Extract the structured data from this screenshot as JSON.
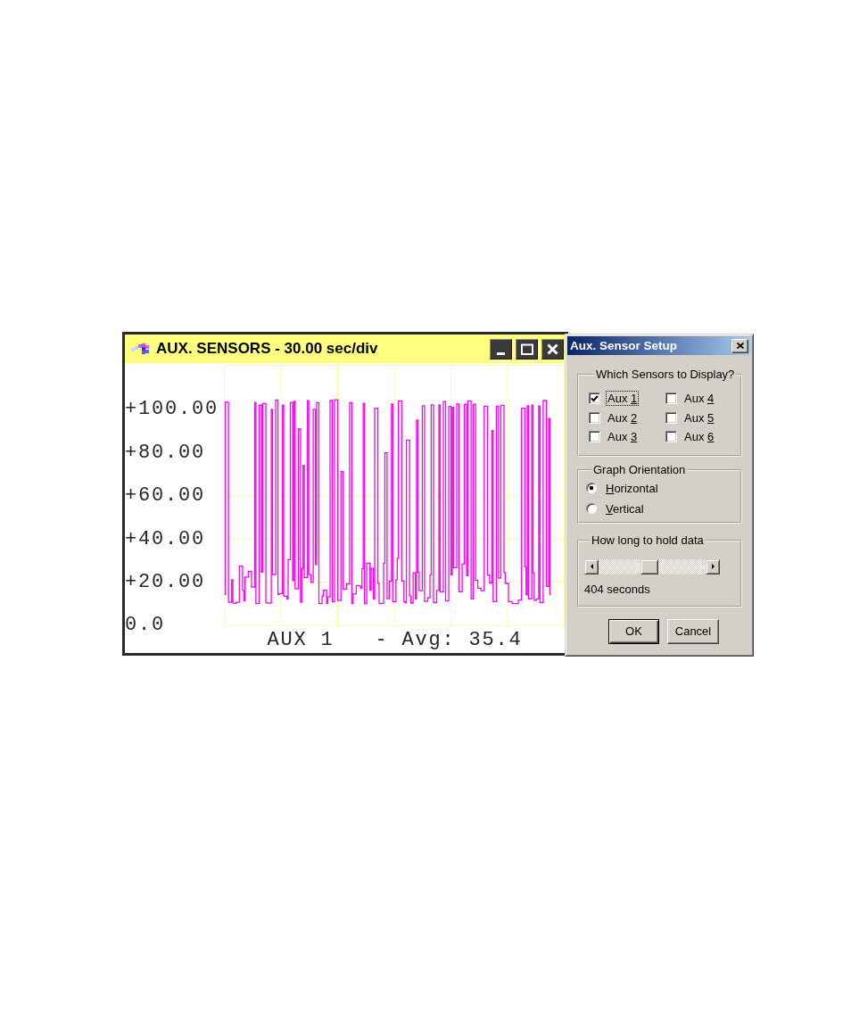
{
  "graph_window": {
    "title": "AUX. SENSORS - 30.00 sec/div",
    "y_axis_labels": [
      "+100.00",
      "+80.00",
      "+60.00",
      "+40.00",
      "+20.00",
      "0.0"
    ],
    "trace_label": "AUX 1",
    "average": "- Avg: 35.4"
  },
  "dialog": {
    "title": "Aux. Sensor Setup",
    "sensor_group": {
      "title": "Which Sensors to Display?",
      "sensors": [
        {
          "label": "Aux 1",
          "checked": true,
          "focused": true
        },
        {
          "label": "Aux 2",
          "checked": false,
          "focused": false
        },
        {
          "label": "Aux 3",
          "checked": false,
          "focused": false
        },
        {
          "label": "Aux 4",
          "checked": false,
          "focused": false
        },
        {
          "label": "Aux 5",
          "checked": false,
          "focused": false
        },
        {
          "label": "Aux 6",
          "checked": false,
          "focused": false
        }
      ]
    },
    "orientation_group": {
      "title": "Graph Orientation",
      "options": [
        {
          "label": "Horizontal",
          "selected": true
        },
        {
          "label": "Vertical",
          "selected": false
        }
      ]
    },
    "hold_group": {
      "title": "How long to hold data",
      "level": 0.47,
      "reading": "404 seconds"
    },
    "buttons": [
      {
        "label": "OK",
        "default": true
      },
      {
        "label": "Cancel",
        "default": false
      }
    ]
  }
}
